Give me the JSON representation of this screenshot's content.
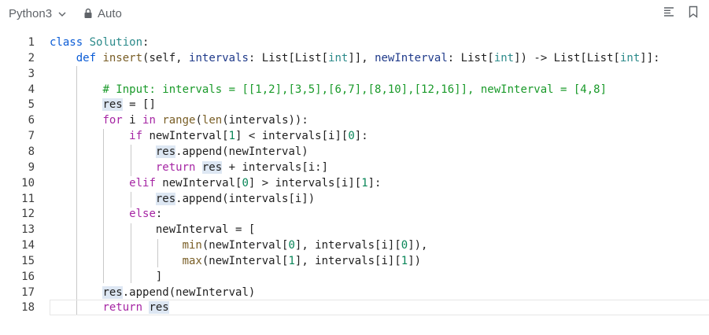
{
  "toolbar": {
    "language": "Python3",
    "mode": "Auto",
    "icons": [
      "chevron-down-icon",
      "lock-icon",
      "format-icon",
      "bookmark-icon"
    ]
  },
  "editor": {
    "lines": [
      {
        "n": "1",
        "tokens": [
          [
            "kw2",
            "class"
          ],
          [
            "",
            " "
          ],
          [
            "cls",
            "Solution"
          ],
          [
            "",
            ":"
          ]
        ]
      },
      {
        "n": "2",
        "tokens": [
          [
            "",
            "    "
          ],
          [
            "kw2",
            "def"
          ],
          [
            "",
            " "
          ],
          [
            "fn",
            "insert"
          ],
          [
            "",
            "(self, "
          ],
          [
            "param",
            "intervals"
          ],
          [
            "",
            ": List[List["
          ],
          [
            "ty",
            "int"
          ],
          [
            "",
            "]], "
          ],
          [
            "param",
            "newInterval"
          ],
          [
            "",
            ": List["
          ],
          [
            "ty",
            "int"
          ],
          [
            "",
            "]) -> List[List["
          ],
          [
            "ty",
            "int"
          ],
          [
            "",
            "]]:"
          ]
        ]
      },
      {
        "n": "3",
        "tokens": [
          [
            "",
            ""
          ]
        ]
      },
      {
        "n": "4",
        "tokens": [
          [
            "",
            "        "
          ],
          [
            "cm",
            "# Input: intervals = [[1,2],[3,5],[6,7],[8,10],[12,16]], newInterval = [4,8]"
          ]
        ]
      },
      {
        "n": "5",
        "tokens": [
          [
            "",
            "        "
          ],
          [
            "hl",
            "res"
          ],
          [
            "",
            " = []"
          ]
        ]
      },
      {
        "n": "6",
        "tokens": [
          [
            "",
            "        "
          ],
          [
            "kw",
            "for"
          ],
          [
            "",
            " i "
          ],
          [
            "kw",
            "in"
          ],
          [
            "",
            " "
          ],
          [
            "fn",
            "range"
          ],
          [
            "",
            "("
          ],
          [
            "fn",
            "len"
          ],
          [
            "",
            "(intervals)):"
          ]
        ]
      },
      {
        "n": "7",
        "tokens": [
          [
            "",
            "            "
          ],
          [
            "kw",
            "if"
          ],
          [
            "",
            " newInterval["
          ],
          [
            "num",
            "1"
          ],
          [
            "",
            "] < intervals[i]["
          ],
          [
            "num",
            "0"
          ],
          [
            "",
            "]:"
          ]
        ]
      },
      {
        "n": "8",
        "tokens": [
          [
            "",
            "                "
          ],
          [
            "hl",
            "res"
          ],
          [
            "",
            ".append(newInterval)"
          ]
        ]
      },
      {
        "n": "9",
        "tokens": [
          [
            "",
            "                "
          ],
          [
            "kw",
            "return"
          ],
          [
            "",
            " "
          ],
          [
            "hl",
            "res"
          ],
          [
            "",
            " + intervals[i:]"
          ]
        ]
      },
      {
        "n": "10",
        "tokens": [
          [
            "",
            "            "
          ],
          [
            "kw",
            "elif"
          ],
          [
            "",
            " newInterval["
          ],
          [
            "num",
            "0"
          ],
          [
            "",
            "] > intervals[i]["
          ],
          [
            "num",
            "1"
          ],
          [
            "",
            "]:"
          ]
        ]
      },
      {
        "n": "11",
        "tokens": [
          [
            "",
            "                "
          ],
          [
            "hl",
            "res"
          ],
          [
            "",
            ".append(intervals[i])"
          ]
        ]
      },
      {
        "n": "12",
        "tokens": [
          [
            "",
            "            "
          ],
          [
            "kw",
            "else"
          ],
          [
            "",
            ":"
          ]
        ]
      },
      {
        "n": "13",
        "tokens": [
          [
            "",
            "                newInterval = ["
          ]
        ]
      },
      {
        "n": "14",
        "tokens": [
          [
            "",
            "                    "
          ],
          [
            "fn",
            "min"
          ],
          [
            "",
            "(newInterval["
          ],
          [
            "num",
            "0"
          ],
          [
            "",
            "], intervals[i]["
          ],
          [
            "num",
            "0"
          ],
          [
            "",
            "]),"
          ]
        ]
      },
      {
        "n": "15",
        "tokens": [
          [
            "",
            "                    "
          ],
          [
            "fn",
            "max"
          ],
          [
            "",
            "(newInterval["
          ],
          [
            "num",
            "1"
          ],
          [
            "",
            "], intervals[i]["
          ],
          [
            "num",
            "1"
          ],
          [
            "",
            "])"
          ]
        ]
      },
      {
        "n": "16",
        "tokens": [
          [
            "",
            "                ]"
          ]
        ]
      },
      {
        "n": "17",
        "tokens": [
          [
            "",
            "        "
          ],
          [
            "hl",
            "res"
          ],
          [
            "",
            ".append(newInterval)"
          ]
        ]
      },
      {
        "n": "18",
        "tokens": [
          [
            "",
            "        "
          ],
          [
            "kw",
            "return"
          ],
          [
            "",
            " "
          ],
          [
            "hl",
            "res"
          ]
        ]
      }
    ],
    "active_line": "18"
  }
}
